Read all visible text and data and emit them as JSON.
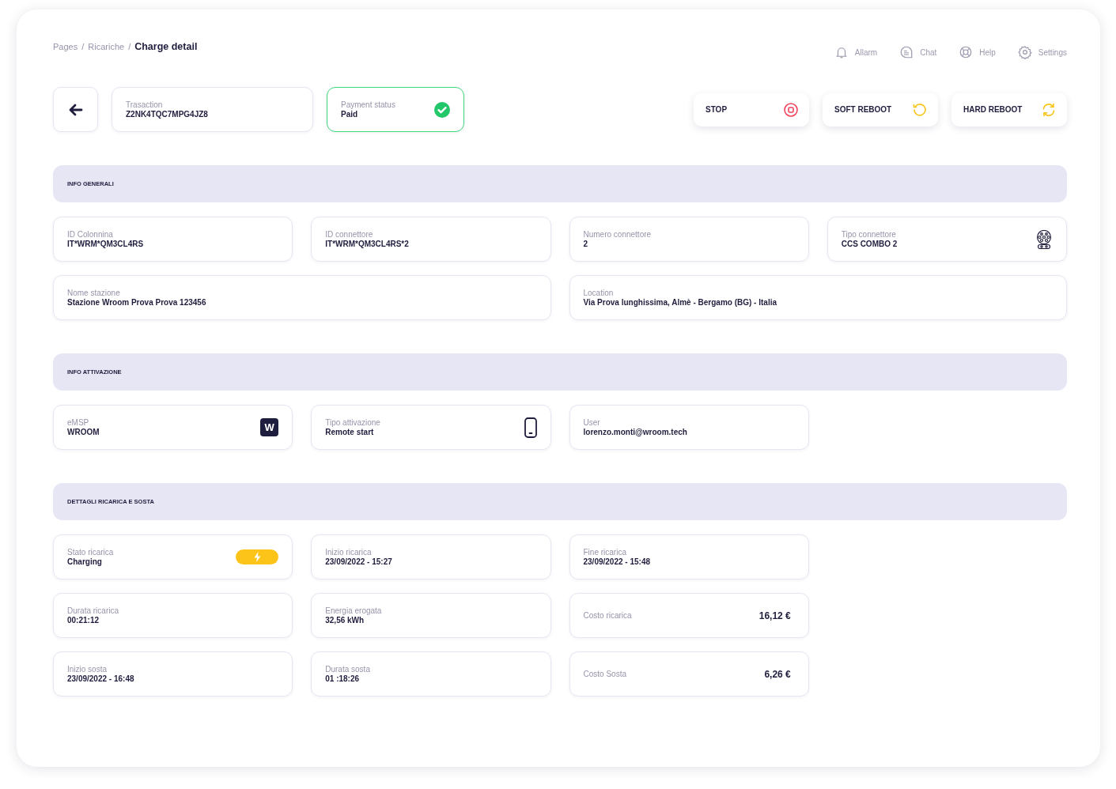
{
  "breadcrumb": {
    "separator": "/",
    "items": [
      {
        "label": "Pages",
        "current": false
      },
      {
        "label": "Ricariche",
        "current": false
      },
      {
        "label": "Charge detail",
        "current": true
      }
    ]
  },
  "top_nav": [
    {
      "kind": "bell",
      "label": "Allarm"
    },
    {
      "kind": "chat",
      "label": "Chat"
    },
    {
      "kind": "help",
      "label": "Help"
    },
    {
      "kind": "settings",
      "label": "Settings"
    }
  ],
  "transaction": {
    "label": "Trasaction",
    "value": "Z2NK4TQC7MPG4JZ8"
  },
  "payment": {
    "label": "Payment status",
    "value": "Paid",
    "confirmed": true
  },
  "actions": [
    {
      "kind": "stop",
      "label": "STOP"
    },
    {
      "kind": "soft-reboot",
      "label": "SOFT REBOOT"
    },
    {
      "kind": "hard-reboot",
      "label": "HARD REBOOT"
    }
  ],
  "sections": [
    {
      "title": "INFO GENERALI",
      "fields": [
        {
          "kind": "stacked",
          "label": "ID Colonnina",
          "value": "IT*WRM*QM3CL4RS",
          "wide": false
        },
        {
          "kind": "stacked",
          "label": "ID connettore",
          "value": "IT*WRM*QM3CL4RS*2",
          "wide": false
        },
        {
          "kind": "stacked",
          "label": "Numero connettore",
          "value": "2",
          "wide": false
        },
        {
          "kind": "connector",
          "label": "Tipo connettore",
          "value": "CCS COMBO 2",
          "wide": false
        },
        {
          "kind": "stacked",
          "label": "Nome stazione",
          "value": "Stazione Wroom Prova Prova 123456",
          "wide": true
        },
        {
          "kind": "stacked",
          "label": "Location",
          "value": "Via Prova lunghissima, Almè - Bergamo (BG) - Italia",
          "wide": true
        }
      ]
    },
    {
      "title": "INFO ATTIVAZIONE",
      "fields": [
        {
          "kind": "logo",
          "label": "eMSP",
          "value": "WROOM",
          "wide": false,
          "logo_text": "W"
        },
        {
          "kind": "phone",
          "label": "Tipo attivazione",
          "value": "Remote start",
          "wide": false
        },
        {
          "kind": "stacked",
          "label": "User",
          "value": "lorenzo.monti@wroom.tech",
          "wide": false
        }
      ]
    },
    {
      "title": "DETTAGLI RICARICA E SOSTA",
      "fields": [
        {
          "kind": "charging",
          "label": "Stato ricarica",
          "value": "Charging",
          "wide": false
        },
        {
          "kind": "stacked",
          "label": "Inizio ricarica",
          "value": "23/09/2022 - 15:27",
          "wide": false
        },
        {
          "kind": "stacked",
          "label": "Fine ricarica",
          "value": "23/09/2022 - 15:48",
          "wide": false
        },
        {
          "kind": "filler"
        },
        {
          "kind": "stacked",
          "label": "Durata ricarica",
          "value": "00:21:12",
          "wide": false
        },
        {
          "kind": "stacked",
          "label": "Energia erogata",
          "value": "32,56 kWh",
          "wide": false
        },
        {
          "kind": "cost",
          "label": "Costo ricarica",
          "value": "16,12 €",
          "wide": false
        },
        {
          "kind": "filler"
        },
        {
          "kind": "stacked",
          "label": "Inizio sosta",
          "value": "23/09/2022 - 16:48",
          "wide": false
        },
        {
          "kind": "stacked",
          "label": "Durata sosta",
          "value": "01 :18:26",
          "wide": false
        },
        {
          "kind": "cost",
          "label": "Costo Sosta",
          "value": "6,26 €",
          "wide": false
        }
      ]
    }
  ]
}
